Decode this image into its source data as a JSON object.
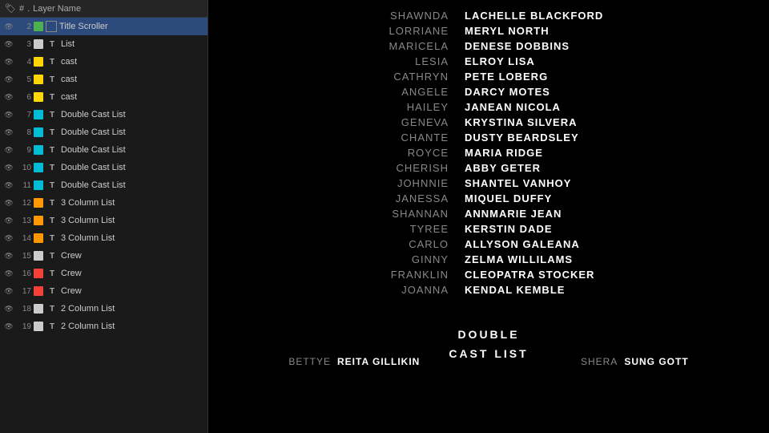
{
  "leftPanel": {
    "headerCols": [
      "#",
      ".",
      "Layer Name"
    ],
    "layers": [
      {
        "id": 2,
        "color": "#4caf50",
        "typeIcon": "box",
        "type": "",
        "name": "Title Scroller",
        "selected": true,
        "expanded": true
      },
      {
        "id": 3,
        "color": "#cccccc",
        "typeIcon": "T",
        "type": "T",
        "name": "List",
        "selected": false,
        "expanded": false
      },
      {
        "id": 4,
        "color": "#ffd700",
        "typeIcon": "T",
        "type": "T",
        "name": "cast",
        "selected": false
      },
      {
        "id": 5,
        "color": "#ffd700",
        "typeIcon": "T",
        "type": "T",
        "name": "cast",
        "selected": false
      },
      {
        "id": 6,
        "color": "#ffd700",
        "typeIcon": "T",
        "type": "T",
        "name": "cast",
        "selected": false
      },
      {
        "id": 7,
        "color": "#00bcd4",
        "typeIcon": "T",
        "type": "T",
        "name": "Double Cast List",
        "selected": false
      },
      {
        "id": 8,
        "color": "#00bcd4",
        "typeIcon": "T",
        "type": "T",
        "name": "Double Cast List",
        "selected": false
      },
      {
        "id": 9,
        "color": "#00bcd4",
        "typeIcon": "T",
        "type": "T",
        "name": "Double Cast List",
        "selected": false
      },
      {
        "id": 10,
        "color": "#00bcd4",
        "typeIcon": "T",
        "type": "T",
        "name": "Double Cast List",
        "selected": false
      },
      {
        "id": 11,
        "color": "#00bcd4",
        "typeIcon": "T",
        "type": "T",
        "name": "Double Cast List",
        "selected": false
      },
      {
        "id": 12,
        "color": "#ff9800",
        "typeIcon": "T",
        "type": "T",
        "name": "3 Column List",
        "selected": false
      },
      {
        "id": 13,
        "color": "#ff9800",
        "typeIcon": "T",
        "type": "T",
        "name": "3 Column List",
        "selected": false
      },
      {
        "id": 14,
        "color": "#ff9800",
        "typeIcon": "T",
        "type": "T",
        "name": "3 Column List",
        "selected": false
      },
      {
        "id": 15,
        "color": "#cccccc",
        "typeIcon": "T",
        "type": "T",
        "name": "Crew",
        "selected": false
      },
      {
        "id": 16,
        "color": "#f44336",
        "typeIcon": "T",
        "type": "T",
        "name": "Crew",
        "selected": false
      },
      {
        "id": 17,
        "color": "#f44336",
        "typeIcon": "T",
        "type": "T",
        "name": "Crew",
        "selected": false
      },
      {
        "id": 18,
        "color": "#cccccc",
        "typeIcon": "T",
        "type": "T",
        "name": "2 Column List",
        "selected": false
      },
      {
        "id": 19,
        "color": "#cccccc",
        "typeIcon": "T",
        "type": "T",
        "name": "2 Column List",
        "selected": false
      }
    ]
  },
  "credits": {
    "castRows": [
      {
        "left": "SHAWNDA",
        "right": "LACHELLE BLACKFORD"
      },
      {
        "left": "LORRIANE",
        "right": "MERYL NORTH"
      },
      {
        "left": "MARICELA",
        "right": "DENESE DOBBINS"
      },
      {
        "left": "LESIA",
        "right": "ELROY LISA"
      },
      {
        "left": "CATHRYN",
        "right": "PETE LOBERG"
      },
      {
        "left": "ANGELE",
        "right": "DARCY MOTES"
      },
      {
        "left": "HAILEY",
        "right": "JANEAN NICOLA"
      },
      {
        "left": "GENEVA",
        "right": "KRYSTINA SILVERA"
      },
      {
        "left": "CHANTE",
        "right": "DUSTY BEARDSLEY"
      },
      {
        "left": "ROYCE",
        "right": "MARIA RIDGE"
      },
      {
        "left": "CHERISH",
        "right": "ABBY GETER"
      },
      {
        "left": "JOHNNIE",
        "right": "SHANTEL VANHOY"
      },
      {
        "left": "JANESSA",
        "right": "MIQUEL DUFFY"
      },
      {
        "left": "SHANNAN",
        "right": "ANNMARIE JEAN"
      },
      {
        "left": "TYREE",
        "right": "KERSTIN DADE"
      },
      {
        "left": "CARLO",
        "right": "ALLYSON GALEANA"
      },
      {
        "left": "GINNY",
        "right": "ZELMA WILLILAMS"
      },
      {
        "left": "FRANKLIN",
        "right": "CLEOPATRA STOCKER"
      },
      {
        "left": "JOANNA",
        "right": "KENDAL KEMBLE"
      }
    ],
    "sectionTitle1": "DOUBLE",
    "sectionTitle2": "CAST LIST",
    "bottomLeft": {
      "name": "BETTYE",
      "value": "REITA GILLIKIN"
    },
    "bottomRight": {
      "name": "SHERA",
      "value": "SUNG GOTT"
    }
  }
}
